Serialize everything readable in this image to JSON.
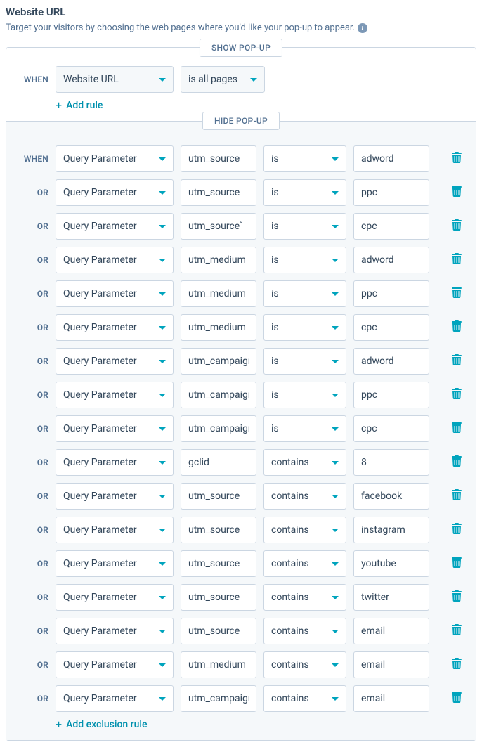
{
  "header": {
    "title": "Website URL",
    "description": "Target your visitors by choosing the web pages where you'd like your pop-up to appear."
  },
  "labels": {
    "when": "WHEN",
    "or": "OR"
  },
  "show_section": {
    "tab": "SHOW POP-UP",
    "prefix": "WHEN",
    "type": "Website URL",
    "operator": "is all pages",
    "add_rule": "Add rule"
  },
  "hide_section": {
    "tab": "HIDE POP-UP",
    "add_rule": "Add exclusion rule",
    "rules": [
      {
        "prefix": "WHEN",
        "type": "Query Parameter",
        "param": "utm_source",
        "op": "is",
        "val": "adword"
      },
      {
        "prefix": "OR",
        "type": "Query Parameter",
        "param": "utm_source",
        "op": "is",
        "val": "ppc"
      },
      {
        "prefix": "OR",
        "type": "Query Parameter",
        "param": "utm_source`",
        "op": "is",
        "val": "cpc"
      },
      {
        "prefix": "OR",
        "type": "Query Parameter",
        "param": "utm_medium",
        "op": "is",
        "val": "adword"
      },
      {
        "prefix": "OR",
        "type": "Query Parameter",
        "param": "utm_medium",
        "op": "is",
        "val": "ppc"
      },
      {
        "prefix": "OR",
        "type": "Query Parameter",
        "param": "utm_medium",
        "op": "is",
        "val": "cpc"
      },
      {
        "prefix": "OR",
        "type": "Query Parameter",
        "param": "utm_campaign",
        "op": "is",
        "val": "adword"
      },
      {
        "prefix": "OR",
        "type": "Query Parameter",
        "param": "utm_campaign",
        "op": "is",
        "val": "ppc"
      },
      {
        "prefix": "OR",
        "type": "Query Parameter",
        "param": "utm_campaign",
        "op": "is",
        "val": "cpc"
      },
      {
        "prefix": "OR",
        "type": "Query Parameter",
        "param": "gclid",
        "op": "contains",
        "val": "8"
      },
      {
        "prefix": "OR",
        "type": "Query Parameter",
        "param": "utm_source",
        "op": "contains",
        "val": "facebook"
      },
      {
        "prefix": "OR",
        "type": "Query Parameter",
        "param": "utm_source",
        "op": "contains",
        "val": "instagram"
      },
      {
        "prefix": "OR",
        "type": "Query Parameter",
        "param": "utm_source",
        "op": "contains",
        "val": "youtube"
      },
      {
        "prefix": "OR",
        "type": "Query Parameter",
        "param": "utm_source",
        "op": "contains",
        "val": "twitter"
      },
      {
        "prefix": "OR",
        "type": "Query Parameter",
        "param": "utm_source",
        "op": "contains",
        "val": "email"
      },
      {
        "prefix": "OR",
        "type": "Query Parameter",
        "param": "utm_medium",
        "op": "contains",
        "val": "email"
      },
      {
        "prefix": "OR",
        "type": "Query Parameter",
        "param": "utm_campaign",
        "op": "contains",
        "val": "email"
      }
    ]
  }
}
